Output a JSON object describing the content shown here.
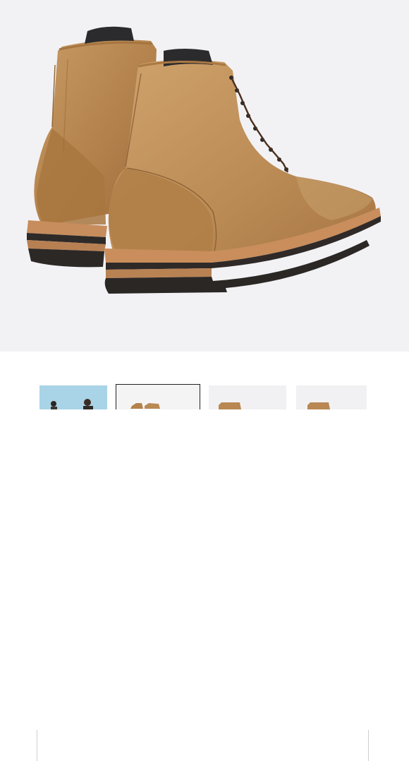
{
  "product_view": {
    "main_image": "tan-leather-lace-up-boots-rear-view",
    "selected_thumbnail_index": 1
  },
  "gallery": {
    "thumbnails": [
      {
        "image": "lifestyle-model-photo",
        "selected": false
      },
      {
        "image": "boots-rear-view",
        "selected": true
      },
      {
        "image": "boot-side-view",
        "selected": false
      },
      {
        "image": "boot-front-view",
        "selected": false
      }
    ]
  },
  "colors": {
    "background": "#f2f2f4",
    "leather": "#b98a54",
    "leather_dark": "#8e6234",
    "sole_welt": "#c58b5c",
    "sole_rubber": "#2e2a28"
  }
}
